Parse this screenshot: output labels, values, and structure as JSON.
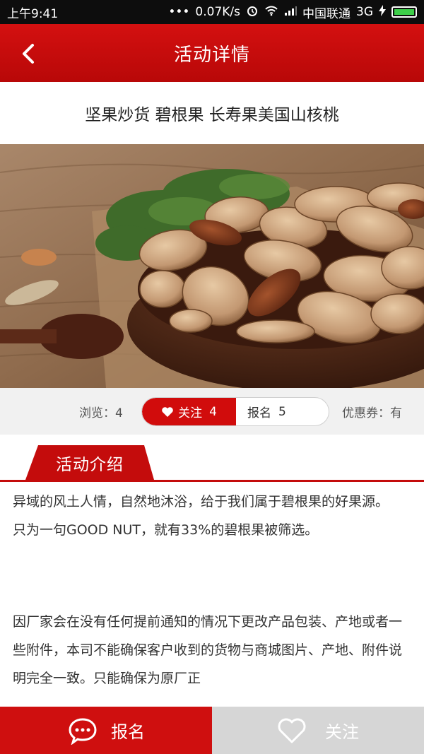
{
  "status_bar": {
    "time": "上午9:41",
    "network_speed": "0.07K/s",
    "carrier": "中国联通",
    "network_type": "3G"
  },
  "header": {
    "title": "活动详情"
  },
  "product": {
    "title": "坚果炒货 碧根果 长寿果美国山核桃"
  },
  "stats": {
    "views_label": "浏览：",
    "views_count": "4",
    "follow_label": "关注",
    "follow_count": "4",
    "signup_label": "报名",
    "signup_count": "5",
    "coupon_label": "优惠券：",
    "coupon_value": "有"
  },
  "section": {
    "title": "活动介绍"
  },
  "description": {
    "p1": "异域的风土人情，自然地沐浴，给于我们属于碧根果的好果源。",
    "p2": "只为一句GOOD  NUT，就有33%的碧根果被筛选。",
    "p3": "因厂家会在没有任何提前通知的情况下更改产品包装、产地或者一些附件，本司不能确保客户收到的货物与商城图片、产地、附件说明完全一致。只能确保为原厂正"
  },
  "bottom_bar": {
    "signup_label": "报名",
    "follow_label": "关注"
  },
  "colors": {
    "brand_red": "#cf0f0f",
    "inactive_gray": "#d6d6d6"
  }
}
